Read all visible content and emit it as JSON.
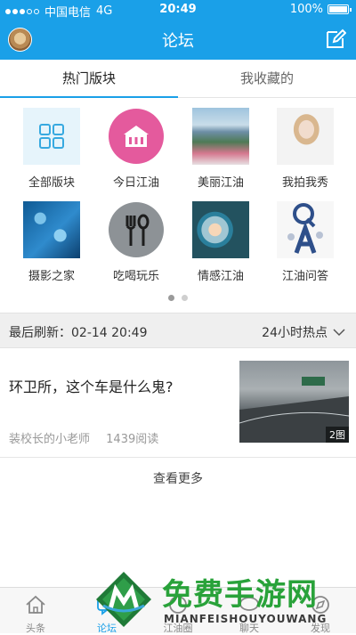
{
  "status_bar": {
    "carrier": "中国电信",
    "network": "4G",
    "time": "20:49",
    "battery": "100%"
  },
  "nav": {
    "title": "论坛"
  },
  "tabs": [
    {
      "label": "热门版块"
    },
    {
      "label": "我收藏的"
    }
  ],
  "categories": [
    {
      "label": "全部版块",
      "icon": "grid-icon"
    },
    {
      "label": "今日江油",
      "icon": "building-icon"
    },
    {
      "label": "美丽江油",
      "icon": "landscape-photo"
    },
    {
      "label": "我拍我秀",
      "icon": "portrait-photo"
    },
    {
      "label": "摄影之家",
      "icon": "water-drops-photo"
    },
    {
      "label": "吃喝玩乐",
      "icon": "fork-spoon-icon"
    },
    {
      "label": "情感江油",
      "icon": "window-portrait-photo"
    },
    {
      "label": "江油问答",
      "icon": "qa-figure-icon"
    }
  ],
  "pager": {
    "pages": 2,
    "current": 1
  },
  "refresh": {
    "label": "最后刷新：02-14 20:49",
    "filter": "24小时热点"
  },
  "post": {
    "title": "环卫所，这个车是什么鬼?",
    "author": "装校长的小老师",
    "views": "1439阅读",
    "image_badge": "2图"
  },
  "more_label": "查看更多",
  "bottom_nav": [
    {
      "label": "头条",
      "icon": "home-icon"
    },
    {
      "label": "论坛",
      "icon": "forum-icon"
    },
    {
      "label": "江油圈",
      "icon": "circle-icon"
    },
    {
      "label": "聊天",
      "icon": "chat-icon"
    },
    {
      "label": "发现",
      "icon": "discover-icon"
    }
  ],
  "watermark": {
    "text": "免费手游网",
    "sub": "MIANFEISHOUYOUWANG"
  },
  "colors": {
    "accent": "#1aa0e8",
    "watermark_green": "#29a23a"
  }
}
